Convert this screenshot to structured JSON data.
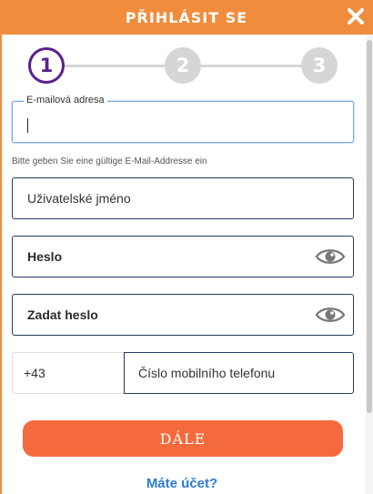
{
  "header": {
    "title": "PŘIHLÁSIT SE",
    "close_icon": "close-icon"
  },
  "stepper": {
    "steps": [
      "1",
      "2",
      "3"
    ],
    "active_step": 1,
    "active_color": "#5b1f8c",
    "inactive_color": "#d6d6d6"
  },
  "form": {
    "email": {
      "label": "E-mailová adresa",
      "value": ""
    },
    "email_hint": "Bitte geben Sie eine gültige E-Mail-Addresse ein",
    "username": {
      "placeholder": "Uživatelské jméno"
    },
    "password": {
      "placeholder": "Heslo",
      "icon": "eye-icon"
    },
    "password_confirm": {
      "placeholder": "Zadat heslo",
      "icon": "eye-icon"
    },
    "phone": {
      "country_code": "+43",
      "placeholder": "Číslo mobilního telefonu"
    }
  },
  "actions": {
    "next_label": "DÁLE",
    "account_link": "Máte účet?"
  },
  "colors": {
    "header": "#f28c3d",
    "button": "#f46a3d",
    "link": "#2c7ad6",
    "field_border": "#243a5e"
  }
}
